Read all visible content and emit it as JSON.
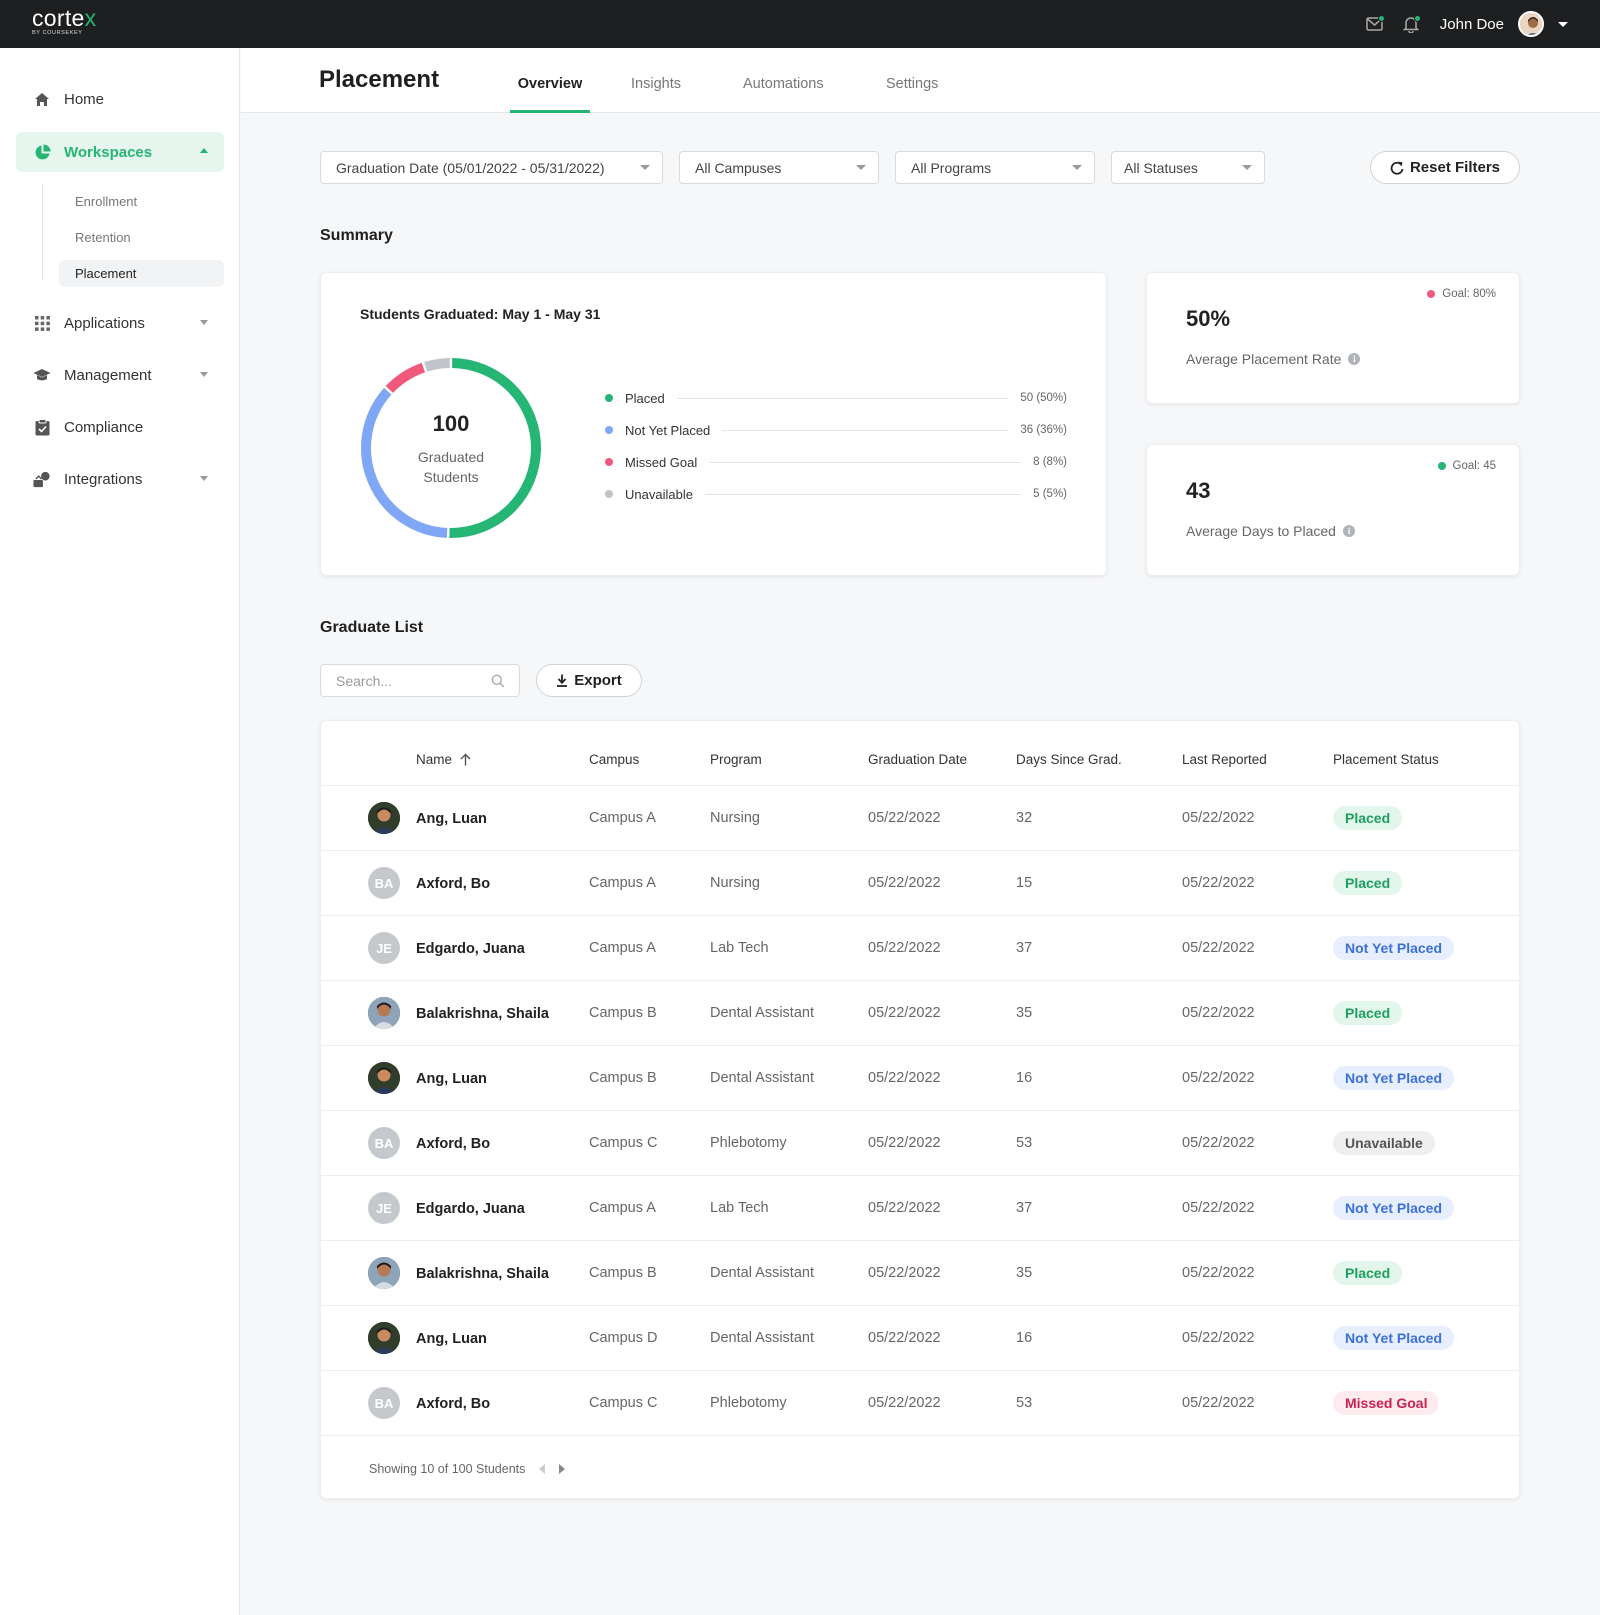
{
  "brand": {
    "name_main": "corte",
    "name_accent": "x",
    "tagline": "BY COURSEKEY"
  },
  "topbar": {
    "user_name": "John Doe"
  },
  "sidebar": {
    "items": [
      {
        "label": "Home",
        "icon": "home-icon"
      },
      {
        "label": "Workspaces",
        "icon": "pie-chart-icon"
      },
      {
        "label": "Applications",
        "icon": "grid-icon"
      },
      {
        "label": "Management",
        "icon": "graduation-cap-icon"
      },
      {
        "label": "Compliance",
        "icon": "clipboard-check-icon"
      },
      {
        "label": "Integrations",
        "icon": "integrations-icon"
      }
    ],
    "sub_items": [
      "Enrollment",
      "Retention",
      "Placement"
    ]
  },
  "header": {
    "title": "Placement",
    "tabs": [
      "Overview",
      "Insights",
      "Automations",
      "Settings"
    ],
    "active_tab": "Overview"
  },
  "filters": {
    "date": "Graduation Date (05/01/2022 - 05/31/2022)",
    "campus": "All Campuses",
    "program": "All Programs",
    "status": "All Statuses",
    "reset_label": "Reset Filters"
  },
  "summary": {
    "section_title": "Summary",
    "chart_title": "Students Graduated: May 1 - May 31",
    "center_value": "100",
    "center_label_1": "Graduated",
    "center_label_2": "Students",
    "legend": [
      {
        "label": "Placed",
        "value_text": "50 (50%)",
        "color": "#25b574"
      },
      {
        "label": "Not Yet Placed",
        "value_text": "36 (36%)",
        "color": "#7fa7f5"
      },
      {
        "label": "Missed Goal",
        "value_text": "8 (8%)",
        "color": "#f0587c"
      },
      {
        "label": "Unavailable",
        "value_text": "5 (5%)",
        "color": "#c1c4c8"
      }
    ],
    "kpis": [
      {
        "value": "50%",
        "label": "Average Placement Rate",
        "goal": "Goal: 80%",
        "goal_color": "#f0587c"
      },
      {
        "value": "43",
        "label": "Average Days to Placed",
        "goal": "Goal: 45",
        "goal_color": "#25b574"
      }
    ]
  },
  "chart_data": {
    "type": "pie",
    "title": "Students Graduated: May 1 - May 31",
    "categories": [
      "Placed",
      "Not Yet Placed",
      "Missed Goal",
      "Unavailable"
    ],
    "values": [
      50,
      36,
      8,
      5
    ],
    "percentages": [
      50,
      36,
      8,
      5
    ],
    "colors": [
      "#25b574",
      "#7fa7f5",
      "#f0587c",
      "#c1c4c8"
    ],
    "total": 100,
    "donut": true
  },
  "graduate_list": {
    "section_title": "Graduate List",
    "search_placeholder": "Search...",
    "export_label": "Export",
    "columns": [
      "Name",
      "Campus",
      "Program",
      "Graduation Date",
      "Days Since Grad.",
      "Last Reported",
      "Placement Status"
    ],
    "rows": [
      {
        "initials": "",
        "photo": true,
        "name": "Ang, Luan",
        "campus": "Campus A",
        "program": "Nursing",
        "grad_date": "05/22/2022",
        "days": "32",
        "last_reported": "05/22/2022",
        "status": "Placed",
        "status_kind": "placed"
      },
      {
        "initials": "BA",
        "photo": false,
        "name": "Axford, Bo",
        "campus": "Campus A",
        "program": "Nursing",
        "grad_date": "05/22/2022",
        "days": "15",
        "last_reported": "05/22/2022",
        "status": "Placed",
        "status_kind": "placed"
      },
      {
        "initials": "JE",
        "photo": false,
        "name": "Edgardo, Juana",
        "campus": "Campus A",
        "program": "Lab Tech",
        "grad_date": "05/22/2022",
        "days": "37",
        "last_reported": "05/22/2022",
        "status": "Not Yet Placed",
        "status_kind": "notyet"
      },
      {
        "initials": "",
        "photo": true,
        "name": "Balakrishna, Shaila",
        "campus": "Campus B",
        "program": "Dental Assistant",
        "grad_date": "05/22/2022",
        "days": "35",
        "last_reported": "05/22/2022",
        "status": "Placed",
        "status_kind": "placed"
      },
      {
        "initials": "",
        "photo": true,
        "name": "Ang, Luan",
        "campus": "Campus B",
        "program": "Dental Assistant",
        "grad_date": "05/22/2022",
        "days": "16",
        "last_reported": "05/22/2022",
        "status": "Not Yet Placed",
        "status_kind": "notyet"
      },
      {
        "initials": "BA",
        "photo": false,
        "name": "Axford, Bo",
        "campus": "Campus C",
        "program": "Phlebotomy",
        "grad_date": "05/22/2022",
        "days": "53",
        "last_reported": "05/22/2022",
        "status": "Unavailable",
        "status_kind": "unavail"
      },
      {
        "initials": "JE",
        "photo": false,
        "name": "Edgardo, Juana",
        "campus": "Campus A",
        "program": "Lab Tech",
        "grad_date": "05/22/2022",
        "days": "37",
        "last_reported": "05/22/2022",
        "status": "Not Yet Placed",
        "status_kind": "notyet"
      },
      {
        "initials": "",
        "photo": true,
        "name": "Balakrishna, Shaila",
        "campus": "Campus B",
        "program": "Dental Assistant",
        "grad_date": "05/22/2022",
        "days": "35",
        "last_reported": "05/22/2022",
        "status": "Placed",
        "status_kind": "placed"
      },
      {
        "initials": "",
        "photo": true,
        "name": "Ang, Luan",
        "campus": "Campus D",
        "program": "Dental Assistant",
        "grad_date": "05/22/2022",
        "days": "16",
        "last_reported": "05/22/2022",
        "status": "Not Yet Placed",
        "status_kind": "notyet"
      },
      {
        "initials": "BA",
        "photo": false,
        "name": "Axford, Bo",
        "campus": "Campus C",
        "program": "Phlebotomy",
        "grad_date": "05/22/2022",
        "days": "53",
        "last_reported": "05/22/2022",
        "status": "Missed Goal",
        "status_kind": "missed"
      }
    ],
    "footer_text": "Showing 10 of 100 Students"
  }
}
